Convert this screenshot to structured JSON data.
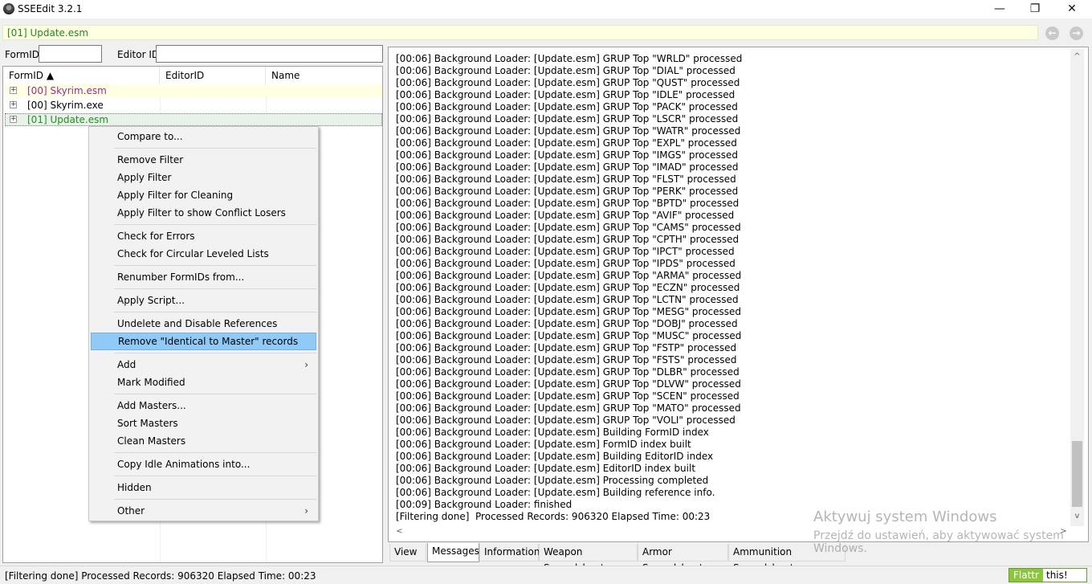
{
  "window": {
    "title": "SSEEdit 3.2.1",
    "minimize": "—",
    "maximize": "❐",
    "close": "✕"
  },
  "pathbar": {
    "text": "[01] Update.esm",
    "back": "←",
    "forward": "→"
  },
  "filters": {
    "formid_label": "FormID",
    "editorid_label": "Editor ID",
    "formid_value": "",
    "editorid_value": ""
  },
  "tree": {
    "columns": [
      "FormID ▲",
      "EditorID",
      "Name"
    ],
    "rows": [
      {
        "label": "[00] Skyrim.esm",
        "color": "#9a2a9a",
        "bg": "#ffffe1"
      },
      {
        "label": "[00] Skyrim.exe",
        "color": "#000000",
        "bg": "#ffffff"
      },
      {
        "label": "[01] Update.esm",
        "color": "#209020",
        "bg": "#e8f2e8"
      }
    ]
  },
  "context_menu": {
    "items": [
      "Compare to...",
      "Remove Filter",
      "Apply Filter",
      "Apply Filter for Cleaning",
      "Apply Filter to show Conflict Losers",
      "Check for Errors",
      "Check for Circular Leveled Lists",
      "Renumber FormIDs from...",
      "Apply Script...",
      "Undelete and Disable References",
      "Remove \"Identical to Master\" records",
      "Add",
      "Mark Modified",
      "Add Masters...",
      "Sort Masters",
      "Clean Masters",
      "Copy Idle Animations into...",
      "Hidden",
      "Other"
    ],
    "highlighted": "Remove \"Identical to Master\" records",
    "submenu_arrow": "›"
  },
  "messages": {
    "lines": [
      "[00:06] Background Loader: [Update.esm] GRUP Top \"WRLD\" processed",
      "[00:06] Background Loader: [Update.esm] GRUP Top \"DIAL\" processed",
      "[00:06] Background Loader: [Update.esm] GRUP Top \"QUST\" processed",
      "[00:06] Background Loader: [Update.esm] GRUP Top \"IDLE\" processed",
      "[00:06] Background Loader: [Update.esm] GRUP Top \"PACK\" processed",
      "[00:06] Background Loader: [Update.esm] GRUP Top \"LSCR\" processed",
      "[00:06] Background Loader: [Update.esm] GRUP Top \"WATR\" processed",
      "[00:06] Background Loader: [Update.esm] GRUP Top \"EXPL\" processed",
      "[00:06] Background Loader: [Update.esm] GRUP Top \"IMGS\" processed",
      "[00:06] Background Loader: [Update.esm] GRUP Top \"IMAD\" processed",
      "[00:06] Background Loader: [Update.esm] GRUP Top \"FLST\" processed",
      "[00:06] Background Loader: [Update.esm] GRUP Top \"PERK\" processed",
      "[00:06] Background Loader: [Update.esm] GRUP Top \"BPTD\" processed",
      "[00:06] Background Loader: [Update.esm] GRUP Top \"AVIF\" processed",
      "[00:06] Background Loader: [Update.esm] GRUP Top \"CAMS\" processed",
      "[00:06] Background Loader: [Update.esm] GRUP Top \"CPTH\" processed",
      "[00:06] Background Loader: [Update.esm] GRUP Top \"IPCT\" processed",
      "[00:06] Background Loader: [Update.esm] GRUP Top \"IPDS\" processed",
      "[00:06] Background Loader: [Update.esm] GRUP Top \"ARMA\" processed",
      "[00:06] Background Loader: [Update.esm] GRUP Top \"ECZN\" processed",
      "[00:06] Background Loader: [Update.esm] GRUP Top \"LCTN\" processed",
      "[00:06] Background Loader: [Update.esm] GRUP Top \"MESG\" processed",
      "[00:06] Background Loader: [Update.esm] GRUP Top \"DOBJ\" processed",
      "[00:06] Background Loader: [Update.esm] GRUP Top \"MUSC\" processed",
      "[00:06] Background Loader: [Update.esm] GRUP Top \"FSTP\" processed",
      "[00:06] Background Loader: [Update.esm] GRUP Top \"FSTS\" processed",
      "[00:06] Background Loader: [Update.esm] GRUP Top \"DLBR\" processed",
      "[00:06] Background Loader: [Update.esm] GRUP Top \"DLVW\" processed",
      "[00:06] Background Loader: [Update.esm] GRUP Top \"SCEN\" processed",
      "[00:06] Background Loader: [Update.esm] GRUP Top \"MATO\" processed",
      "[00:06] Background Loader: [Update.esm] GRUP Top \"VOLI\" processed",
      "[00:06] Background Loader: [Update.esm] Building FormID index",
      "[00:06] Background Loader: [Update.esm] FormID index built",
      "[00:06] Background Loader: [Update.esm] Building EditorID index",
      "[00:06] Background Loader: [Update.esm] EditorID index built",
      "[00:06] Background Loader: [Update.esm] Processing completed",
      "[00:06] Background Loader: [Update.esm] Building reference info.",
      "[00:09] Background Loader: finished",
      "[Filtering done]  Processed Records: 906320 Elapsed Time: 00:23"
    ],
    "scroll_up": "^",
    "scroll_down": "v",
    "scroll_left": "<",
    "scroll_right": ">"
  },
  "tabs": [
    "View",
    "Messages",
    "Information",
    "Weapon Spreadsheet",
    "Armor Spreadsheet",
    "Ammunition Spreadsheet"
  ],
  "active_tab": "Messages",
  "status": {
    "text": "[Filtering done]  Processed Records: 906320 Elapsed Time: 00:23"
  },
  "flattr": {
    "left": "Flattr",
    "right": "this!"
  },
  "watermark": {
    "line1": "Aktywuj system Windows",
    "line2": "Przejdź do ustawień, aby aktywować system Windows."
  },
  "colors": {
    "highlight": "#91c9f7",
    "path_green": "#208a20",
    "path_bg": "#ffffe1",
    "flattr_green": "#8cc63f"
  }
}
